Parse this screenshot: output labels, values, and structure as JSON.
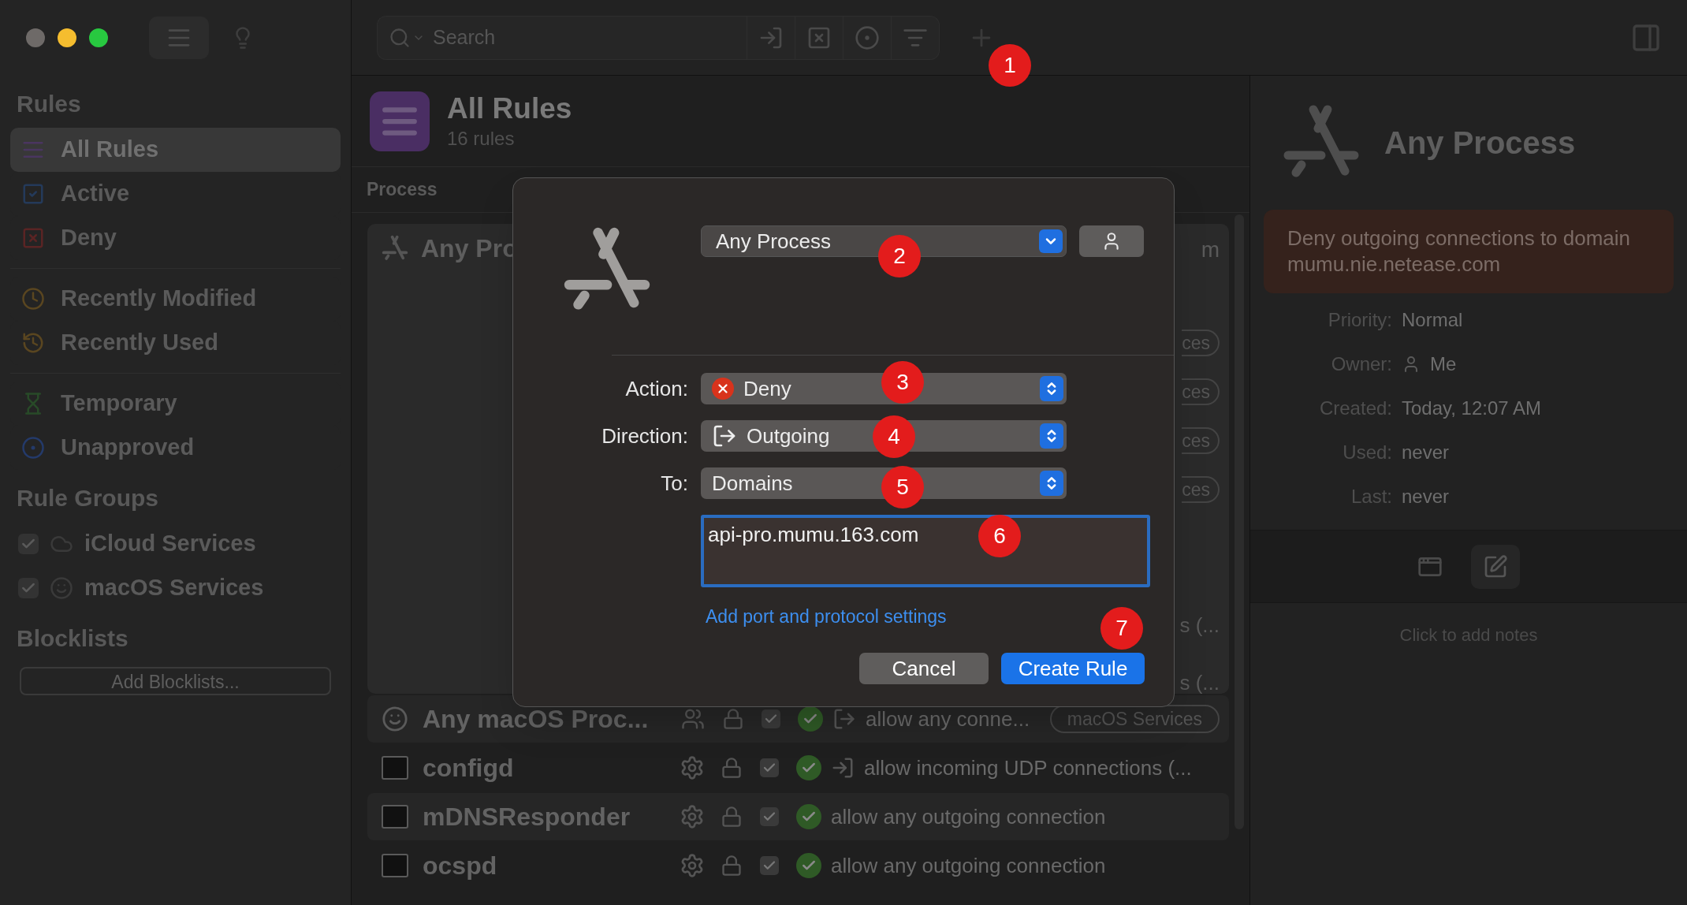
{
  "sidebar": {
    "sections": [
      {
        "title": "Rules",
        "groups": [
          [
            {
              "label": "All Rules",
              "kind": "all",
              "selected": true
            },
            {
              "label": "Active",
              "kind": "active",
              "selected": false
            },
            {
              "label": "Deny",
              "kind": "deny",
              "selected": false
            }
          ],
          [
            {
              "label": "Recently Modified",
              "kind": "modified",
              "selected": false
            },
            {
              "label": "Recently Used",
              "kind": "used",
              "selected": false
            }
          ],
          [
            {
              "label": "Temporary",
              "kind": "temporary",
              "selected": false
            },
            {
              "label": "Unapproved",
              "kind": "unapproved",
              "selected": false
            }
          ]
        ]
      },
      {
        "title": "Rule Groups",
        "items": [
          {
            "label": "iCloud Services",
            "kind": "cloud",
            "checked": true
          },
          {
            "label": "macOS Services",
            "kind": "finder",
            "checked": true
          }
        ]
      },
      {
        "title": "Blocklists",
        "button": "Add Blocklists..."
      }
    ]
  },
  "toolbar": {
    "search": {
      "placeholder": "Search"
    }
  },
  "header": {
    "title": "All Rules",
    "subtitle": "16 rules"
  },
  "list": {
    "column": "Process",
    "expanded": {
      "name": "Any Pro",
      "fragment": "m",
      "pills": [
        "ces",
        "ces",
        "ces",
        "ces"
      ],
      "cut_texts": [
        "s (...",
        "s (..."
      ]
    },
    "rows": [
      {
        "name": "Any macOS Proc...",
        "kind": "group",
        "checked": true,
        "allowed": true,
        "description": "allow any conne...",
        "group": "macOS Services"
      },
      {
        "name": "configd",
        "kind": "incoming",
        "checked": true,
        "allowed": true,
        "description": "allow incoming UDP connections (..."
      },
      {
        "name": "mDNSResponder",
        "kind": "plain",
        "checked": true,
        "allowed": true,
        "description": "allow any outgoing connection"
      },
      {
        "name": "ocspd",
        "kind": "plain",
        "checked": true,
        "allowed": true,
        "description": "allow any outgoing connection"
      }
    ]
  },
  "dialog": {
    "process": "Any Process",
    "fields": [
      {
        "label": "Action:",
        "value": "Deny",
        "kind": "deny"
      },
      {
        "label": "Direction:",
        "value": "Outgoing",
        "kind": "outgoing"
      },
      {
        "label": "To:",
        "value": "Domains",
        "kind": "plain"
      }
    ],
    "domains": "api-pro.mumu.163.com",
    "link": "Add port and protocol settings",
    "buttons": [
      {
        "label": "Cancel",
        "kind": "secondary"
      },
      {
        "label": "Create Rule",
        "kind": "primary"
      }
    ]
  },
  "details": {
    "title": "Any Process",
    "note": "Deny outgoing connections to domain mumu.nie.netease.com",
    "properties": [
      {
        "label": "Priority:",
        "value": "Normal"
      },
      {
        "label": "Owner:",
        "value": "Me",
        "kind": "user"
      },
      {
        "label": "Created:",
        "value": "Today, 12:07 AM"
      },
      {
        "label": "Used:",
        "value": "never"
      },
      {
        "label": "Last:",
        "value": "never"
      }
    ],
    "notes": {
      "placeholder": "Click to add notes"
    }
  },
  "annotations": [
    "1",
    "2",
    "3",
    "4",
    "5",
    "6",
    "7"
  ]
}
